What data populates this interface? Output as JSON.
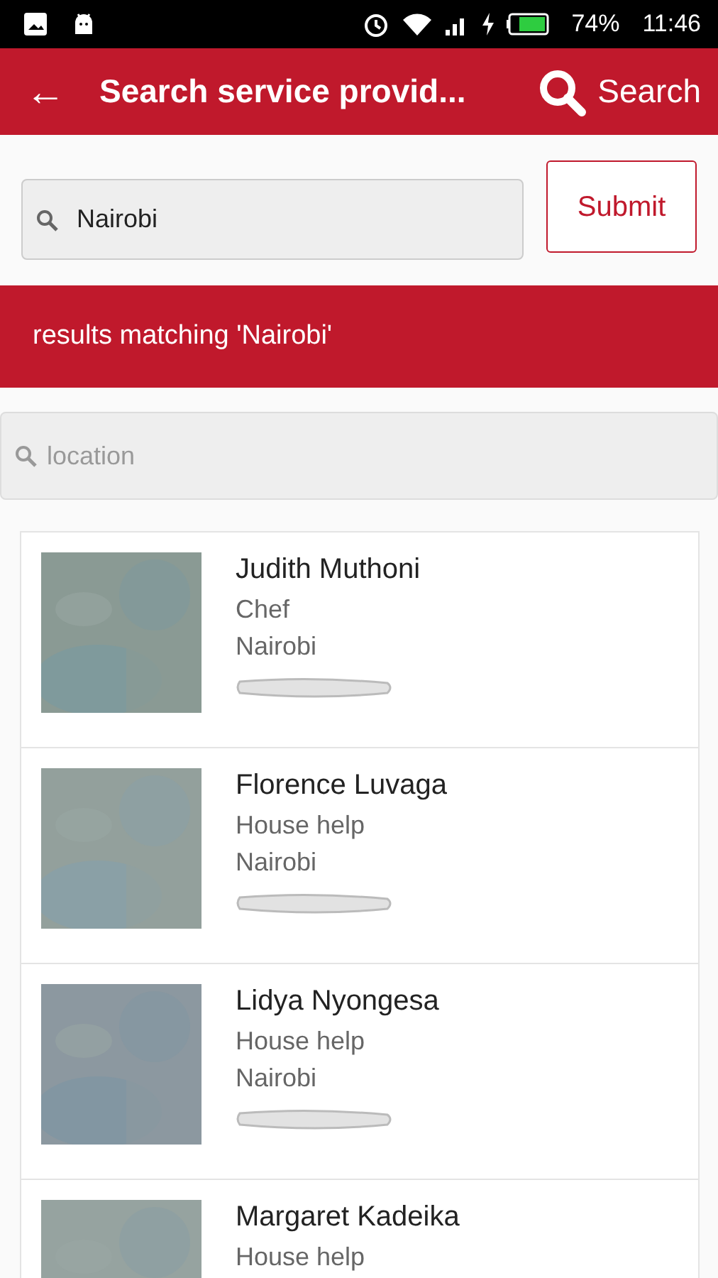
{
  "status_bar": {
    "battery": "74%",
    "time": "11:46"
  },
  "app_bar": {
    "back": "←",
    "title": "Search service provid...",
    "search_label": "Search"
  },
  "search": {
    "value": "Nairobi",
    "button": "Submit"
  },
  "banner": "results matching 'Nairobi'",
  "location_filter": {
    "placeholder": "location"
  },
  "providers": [
    {
      "name": "Judith Muthoni",
      "profession": "Chef",
      "location": "Nairobi"
    },
    {
      "name": "Florence Luvaga",
      "profession": "House help",
      "location": "Nairobi"
    },
    {
      "name": "Lidya Nyongesa",
      "profession": "House help",
      "location": "Nairobi"
    },
    {
      "name": "Margaret Kadeika",
      "profession": "House help"
    }
  ]
}
